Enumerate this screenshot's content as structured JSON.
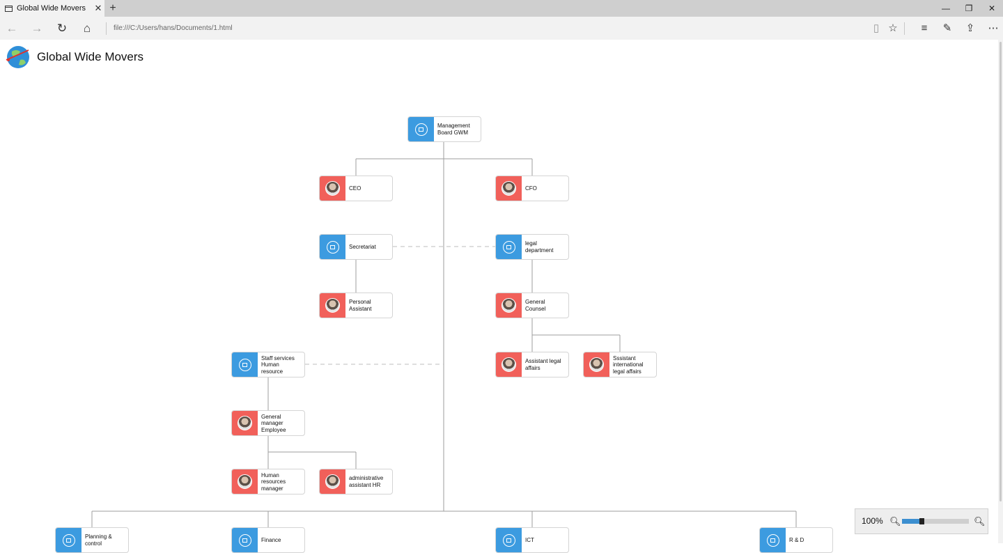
{
  "browser": {
    "tab_title": "Global Wide Movers",
    "tab_close": "✕",
    "new_tab": "+",
    "address": "file:///C:/Users/hans/Documents/1.html",
    "minimize": "—",
    "restore": "❐",
    "close": "✕"
  },
  "page": {
    "title": "Global Wide Movers"
  },
  "org_chart": {
    "management": "Management Board GWM",
    "ceo": "CEO",
    "cfo": "CFO",
    "secretariat": "Secretariat",
    "legal_department": "legal department",
    "personal_assistant": "Personal Assistant",
    "general_counsel": "General Counsel",
    "staff_services": "Staff services Human resource",
    "assistant_legal": "Assistant legal affairs",
    "assistant_international": "Sssistant international legal affairs",
    "general_manager": "General manager Employee",
    "hr_manager": "Human resources manager",
    "admin_assistant": "administrative assistant HR",
    "planning": "Planning & control",
    "finance": "Finance",
    "ict": "ICT",
    "rnd": "R & D"
  },
  "zoom": {
    "label": "100%",
    "level_fraction": 0.26
  },
  "colors": {
    "org_unit": "#3c9be0",
    "person": "#f1605a",
    "connector": "#9e9e9e"
  },
  "icons": {
    "org_unit": "building-icon",
    "person": "person-photo-avatar"
  }
}
